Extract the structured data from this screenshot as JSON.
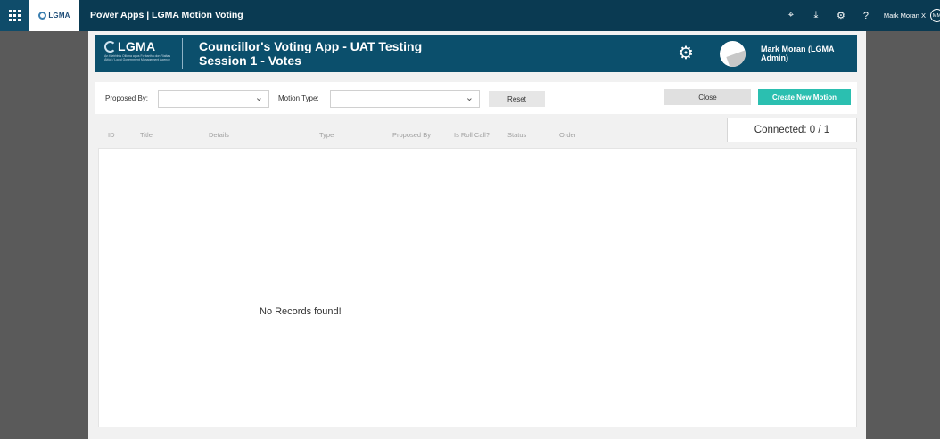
{
  "suite_bar": {
    "logo_text": "LGMA",
    "title": "Power Apps | LGMA Motion Voting",
    "icons": [
      "presentation-icon",
      "download-icon",
      "gear-icon",
      "help-icon"
    ],
    "user_name": "Mark Moran X",
    "avatar_initials": "MM"
  },
  "header": {
    "logo_text": "LGMA",
    "logo_subtext": "An tSeirbhís Oiliúna agus Forbartha don Rialtas Áitiúil / Local Government Management Agency",
    "title_line1": "Councillor's Voting App - UAT Testing",
    "title_line2": "Session 1 - Votes",
    "user_name": "Mark Moran (LGMA Admin)"
  },
  "filters": {
    "proposed_by_label": "Proposed By:",
    "proposed_by_value": "",
    "motion_type_label": "Motion Type:",
    "motion_type_value": "",
    "reset_label": "Reset",
    "close_label": "Close",
    "create_label": "Create New Motion"
  },
  "connected_text": "Connected: 0 / 1",
  "table": {
    "columns": [
      "ID",
      "Title",
      "Details",
      "Type",
      "Proposed By",
      "Is Roll Call?",
      "Status",
      "Order"
    ],
    "rows": [],
    "empty_message": "No Records found!"
  },
  "colors": {
    "suite_bar": "#0a3a52",
    "header": "#0b4f6c",
    "accent": "#2bbfb0",
    "backdrop": "#5a5a5a"
  }
}
